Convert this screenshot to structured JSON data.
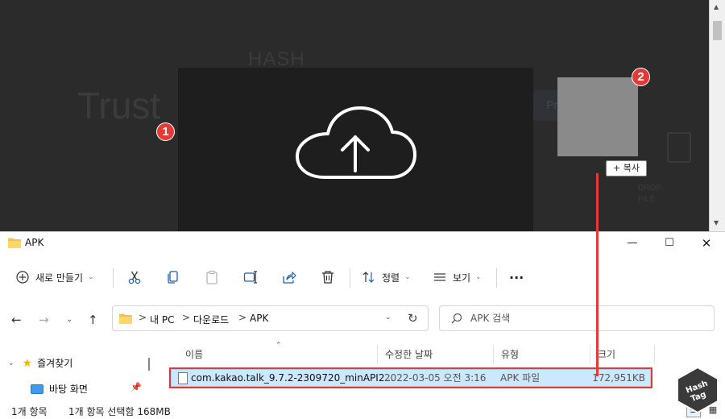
{
  "overlay": {
    "bg_hash": "HASH",
    "bg_trust": "Trust",
    "bg_button": "Preview",
    "bg_small_1": "DROP",
    "bg_small_2": "FILE",
    "badge_2": "2",
    "copy_tooltip": "+ 복사",
    "accent": "#e53935"
  },
  "window": {
    "title": "APK",
    "minimize": "—",
    "maximize": "☐",
    "close": "✕"
  },
  "toolbar": {
    "new_label": "새로 만들기",
    "sort_label": "정렬",
    "view_label": "보기",
    "more_label": "···"
  },
  "address": {
    "crumbs": [
      "내 PC",
      "다운로드",
      "APK"
    ],
    "separator": ">",
    "search_placeholder": "APK 검색"
  },
  "nav": {
    "quick_access": "즐겨찾기",
    "desktop": "바탕 화면"
  },
  "columns": {
    "name": "이름",
    "modified": "수정한 날짜",
    "type": "유형",
    "size": "크기"
  },
  "files": [
    {
      "name": "com.kakao.talk_9.7.2-2309720_minAPI2...",
      "modified": "2022-03-05 오전 3:16",
      "type": "APK 파일",
      "size": "172,951KB"
    }
  ],
  "badge_1": "1",
  "status": {
    "count": "1개 항목",
    "selected": "1개 항목 선택함 168MB"
  },
  "watermark": {
    "line1": "Hash",
    "line2": "Tag"
  }
}
